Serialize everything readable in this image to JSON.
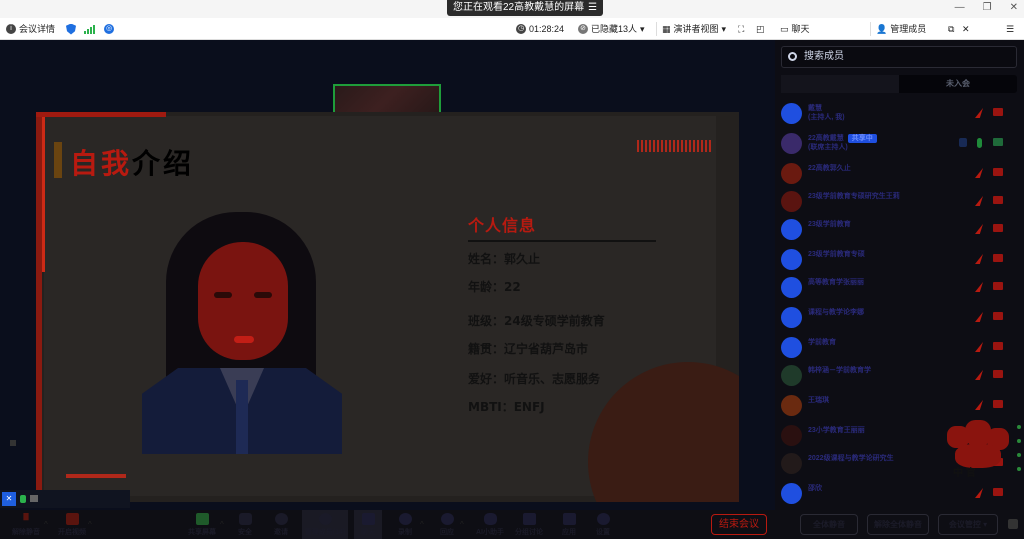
{
  "window": {
    "title": "您正在观看22高教戴慧的屏幕",
    "menu_glyph": "☰"
  },
  "topbar": {
    "meeting_info": "会议详情",
    "timer": "01:28:24",
    "hidden_count": "已隐藏13人",
    "speaker_view": "演讲者视图",
    "chat": "聊天",
    "manage_members": "管理成员"
  },
  "slide": {
    "heading_red": "自我",
    "heading_black": "介绍",
    "info_title": "个人信息",
    "rows": [
      "姓名：郭久止",
      "年龄：22",
      "班级：24级专硕学前教育",
      "籍贯：辽宁省葫芦岛市",
      "爱好：听音乐、志愿服务",
      "MBTI：ENFJ"
    ]
  },
  "panel": {
    "search_placeholder": "搜索成员",
    "tab_all": "成员",
    "tab_all_count": "成员(14)",
    "tab_other": "未入会",
    "members": [
      {
        "name": "戴慧",
        "sub": "(主持人, 我)",
        "tag": "",
        "avatar": "#1f4fe0",
        "status": "muted"
      },
      {
        "name": "22高教戴慧",
        "sub": "(联席主持人)",
        "tag": "共享中",
        "avatar": "#3a2a6a",
        "status": "active"
      },
      {
        "name": "22高教郭久止",
        "sub": "",
        "tag": "",
        "avatar": "#6a1a10",
        "status": "muted"
      },
      {
        "name": "23级学前教育专硕研究生王莉",
        "sub": "",
        "tag": "",
        "avatar": "#5a1410",
        "status": "muted"
      },
      {
        "name": "23级学前教育",
        "sub": "",
        "tag": "",
        "avatar": "#1f4fe0",
        "status": "muted"
      },
      {
        "name": "23级学前教育专硕",
        "sub": "",
        "tag": "",
        "avatar": "#1f4fe0",
        "status": "muted"
      },
      {
        "name": "高等教育学张丽丽",
        "sub": "",
        "tag": "",
        "avatar": "#1f4fe0",
        "status": "muted"
      },
      {
        "name": "课程与教学论李娜",
        "sub": "",
        "tag": "",
        "avatar": "#1f4fe0",
        "status": "muted"
      },
      {
        "name": "学前教育",
        "sub": "",
        "tag": "",
        "avatar": "#1f4fe0",
        "status": "muted"
      },
      {
        "name": "韩梓涵－学前教育学",
        "sub": "",
        "tag": "",
        "avatar": "#1f3a2a",
        "status": "muted"
      },
      {
        "name": "王瑞琪",
        "sub": "",
        "tag": "",
        "avatar": "#6a2a10",
        "status": "muted"
      },
      {
        "name": "23小学教育王丽丽",
        "sub": "",
        "tag": "",
        "avatar": "#2a1010",
        "status": "muted"
      },
      {
        "name": "2022级课程与教学论研究生",
        "sub": "",
        "tag": "",
        "avatar": "#221a1a",
        "status": "muted"
      },
      {
        "name": "邵欣",
        "sub": "",
        "tag": "",
        "avatar": "#1f4fe0",
        "status": "muted"
      }
    ],
    "sticker_text": "中 官",
    "mute_all": "全体静音",
    "unmute_all": "解除全体静音",
    "meeting_control": "会议管控 ▾"
  },
  "toolbar": {
    "unmute": "解除静音",
    "start_video": "开启视频",
    "share_screen": "共享屏幕",
    "security": "安全",
    "invite": "邀请",
    "manage_members": "管理成员(14)",
    "chat": "聊天",
    "record": "录制",
    "reactions": "回应",
    "ai_assistant": "AI小助手",
    "breakout": "分组讨论",
    "apps": "应用",
    "settings": "设置",
    "end_meeting": "结束会议"
  }
}
